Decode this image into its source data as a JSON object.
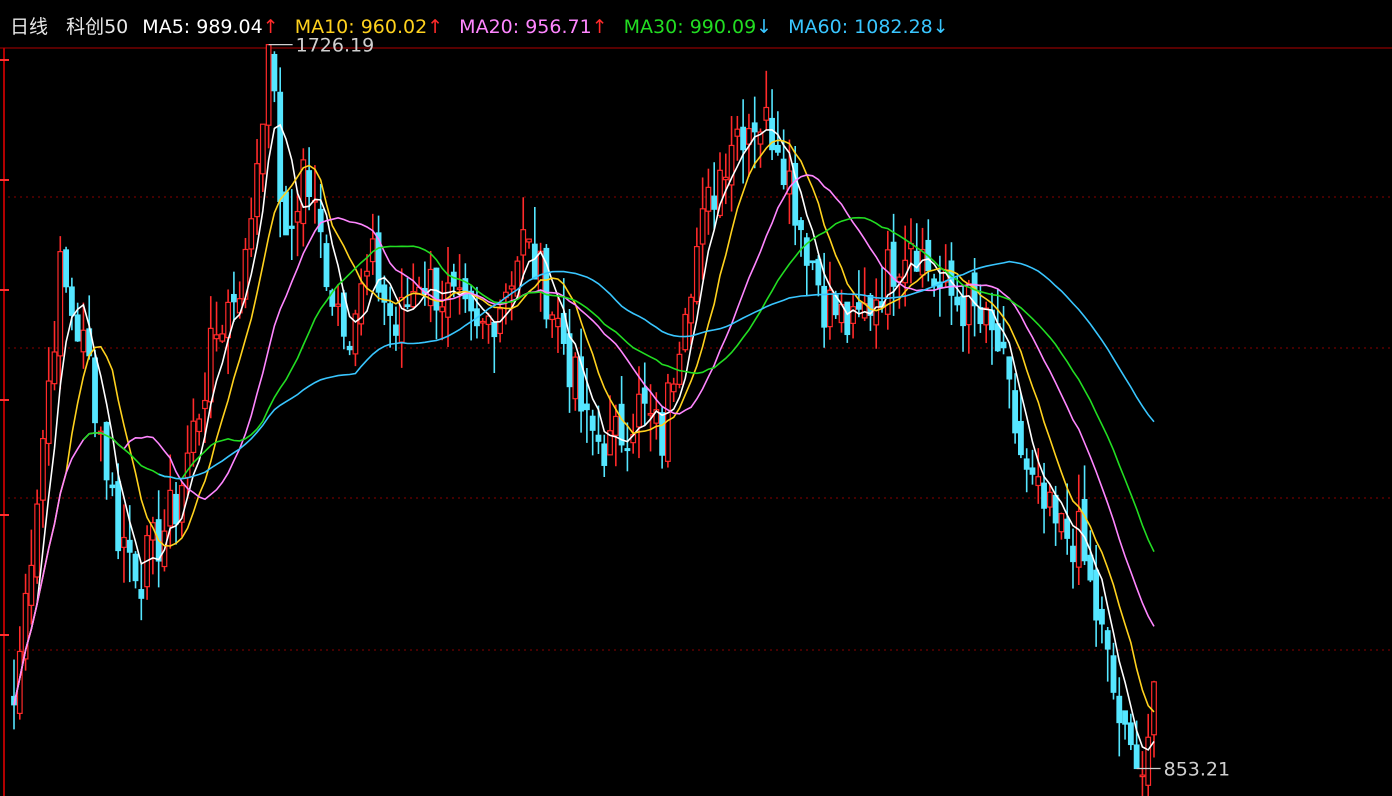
{
  "chart_data": {
    "type": "line",
    "period": "日线",
    "index_name": "科创50",
    "colors": {
      "up": "#ff2a2a",
      "down": "#55e6ff",
      "ma5": "#ffffff",
      "ma10": "#ffd21e",
      "ma20": "#ff86ff",
      "ma30": "#22dd22",
      "ma60": "#39c6ff",
      "grid": "#8a0000",
      "frame": "#b00000",
      "trend_up": "#ff2a2a",
      "trend_down": "#39c6ff"
    },
    "ma_legend": [
      {
        "name": "MA5",
        "value": "989.04",
        "trend": "↑",
        "trend_dir": "up",
        "color": "#ffffff"
      },
      {
        "name": "MA10",
        "value": "960.02",
        "trend": "↑",
        "trend_dir": "up",
        "color": "#ffd21e"
      },
      {
        "name": "MA20",
        "value": "956.71",
        "trend": "↑",
        "trend_dir": "up",
        "color": "#ff86ff"
      },
      {
        "name": "MA30",
        "value": "990.09",
        "trend": "↓",
        "trend_dir": "down",
        "color": "#22dd22"
      },
      {
        "name": "MA60",
        "value": "1082.28",
        "trend": "↓",
        "trend_dir": "down",
        "color": "#39c6ff"
      }
    ],
    "annotations": {
      "max": {
        "label": "1726.19",
        "value": 1726.19,
        "index": 44
      },
      "min": {
        "label": "853.21",
        "value": 853.21,
        "index": 194
      }
    },
    "y_range": [
      820,
      1780
    ],
    "grid": "dotted-horizontal",
    "price_path_approx": [
      [
        0,
        930
      ],
      [
        8,
        1450
      ],
      [
        13,
        1340
      ],
      [
        18,
        1140
      ],
      [
        22,
        1090
      ],
      [
        28,
        1170
      ],
      [
        35,
        1380
      ],
      [
        40,
        1460
      ],
      [
        44,
        1726.19
      ],
      [
        47,
        1470
      ],
      [
        50,
        1580
      ],
      [
        55,
        1430
      ],
      [
        58,
        1390
      ],
      [
        62,
        1460
      ],
      [
        66,
        1380
      ],
      [
        70,
        1450
      ],
      [
        75,
        1420
      ],
      [
        80,
        1370
      ],
      [
        84,
        1420
      ],
      [
        88,
        1490
      ],
      [
        92,
        1430
      ],
      [
        95,
        1370
      ],
      [
        99,
        1260
      ],
      [
        103,
        1240
      ],
      [
        108,
        1290
      ],
      [
        112,
        1250
      ],
      [
        116,
        1430
      ],
      [
        120,
        1530
      ],
      [
        124,
        1620
      ],
      [
        128,
        1640
      ],
      [
        132,
        1620
      ],
      [
        136,
        1510
      ],
      [
        140,
        1420
      ],
      [
        145,
        1380
      ],
      [
        150,
        1440
      ],
      [
        155,
        1500
      ],
      [
        160,
        1430
      ],
      [
        165,
        1410
      ],
      [
        170,
        1360
      ],
      [
        175,
        1200
      ],
      [
        180,
        1140
      ],
      [
        184,
        1130
      ],
      [
        188,
        1010
      ],
      [
        192,
        880
      ],
      [
        194,
        853.21
      ],
      [
        196,
        900
      ],
      [
        197,
        960
      ]
    ]
  }
}
